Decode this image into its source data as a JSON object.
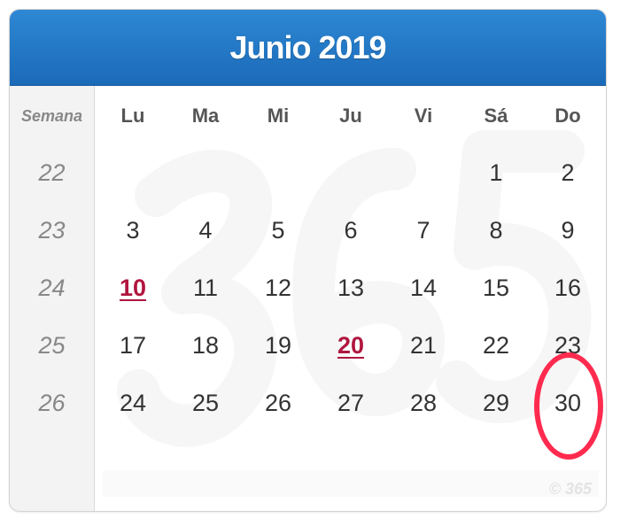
{
  "calendar": {
    "title": "Junio 2019",
    "week_label": "Semana",
    "day_headers": [
      "Lu",
      "Ma",
      "Mi",
      "Ju",
      "Vi",
      "Sá",
      "Do"
    ],
    "week_numbers": [
      "22",
      "23",
      "24",
      "25",
      "26"
    ],
    "weeks": [
      [
        "",
        "",
        "",
        "",
        "",
        "1",
        "2"
      ],
      [
        "3",
        "4",
        "5",
        "6",
        "7",
        "8",
        "9"
      ],
      [
        "10",
        "11",
        "12",
        "13",
        "14",
        "15",
        "16"
      ],
      [
        "17",
        "18",
        "19",
        "20",
        "21",
        "22",
        "23"
      ],
      [
        "24",
        "25",
        "26",
        "27",
        "28",
        "29",
        "30"
      ]
    ],
    "holidays": [
      "10",
      "20"
    ],
    "copyright": "© 365",
    "colors": {
      "header": "#1f74c4",
      "holiday": "#b0163f",
      "circle_annotation": "#ff2b4f"
    }
  }
}
